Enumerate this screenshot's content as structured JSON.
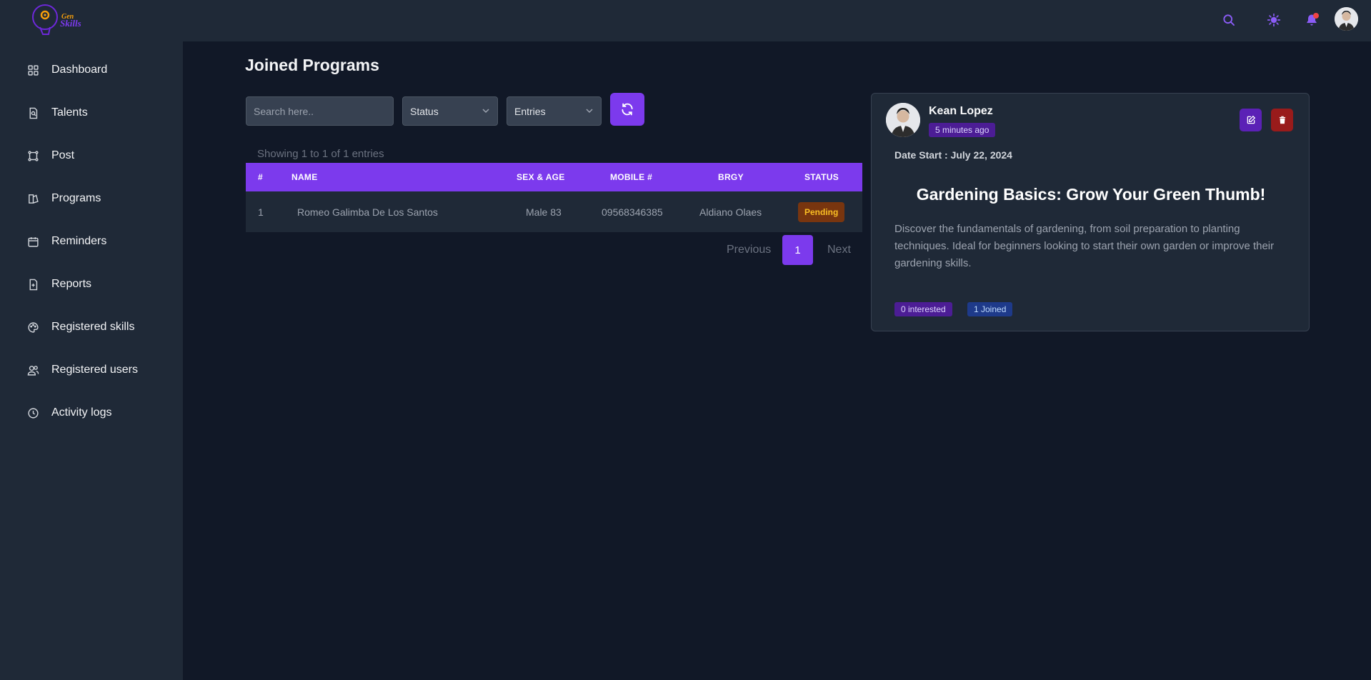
{
  "app": {
    "logo_text_top": "Gen",
    "logo_text_bottom": "Skills",
    "colors": {
      "accent": "#7c3aed",
      "bg": "#111827",
      "panel": "#1f2937"
    }
  },
  "topbar": {
    "icons": [
      "search-icon",
      "sun-icon",
      "bell-icon",
      "user-avatar"
    ]
  },
  "sidebar": {
    "items": [
      {
        "label": "Dashboard",
        "icon": "dashboard-icon"
      },
      {
        "label": "Talents",
        "icon": "talents-icon"
      },
      {
        "label": "Post",
        "icon": "post-icon"
      },
      {
        "label": "Programs",
        "icon": "programs-icon"
      },
      {
        "label": "Reminders",
        "icon": "calendar-icon"
      },
      {
        "label": "Reports",
        "icon": "report-icon"
      },
      {
        "label": "Registered skills",
        "icon": "palette-icon"
      },
      {
        "label": "Registered users",
        "icon": "users-icon"
      },
      {
        "label": "Activity logs",
        "icon": "clock-icon"
      }
    ]
  },
  "main": {
    "title": "Joined Programs",
    "search_placeholder": "Search here..",
    "status_select": "Status",
    "entries_select": "Entries",
    "showing_text": "Showing 1 to 1 of 1 entries",
    "table": {
      "headers": [
        "#",
        "NAME",
        "SEX & AGE",
        "MOBILE #",
        "BRGY",
        "STATUS"
      ],
      "rows": [
        {
          "num": "1",
          "name": "Romeo Galimba De Los Santos",
          "sex_age": "Male 83",
          "mobile": "09568346385",
          "brgy": "Aldiano Olaes",
          "status": "Pending"
        }
      ]
    },
    "pagination": {
      "previous": "Previous",
      "page": "1",
      "next": "Next"
    }
  },
  "card": {
    "author": "Kean Lopez",
    "time_ago": "5 minutes ago",
    "date_start": "Date Start : July 22, 2024",
    "title": "Gardening Basics: Grow Your Green Thumb!",
    "description": "Discover the fundamentals of gardening, from soil preparation to planting techniques. Ideal for beginners looking to start their own garden or improve their gardening skills.",
    "interested": "0 interested",
    "joined": "1 Joined"
  }
}
